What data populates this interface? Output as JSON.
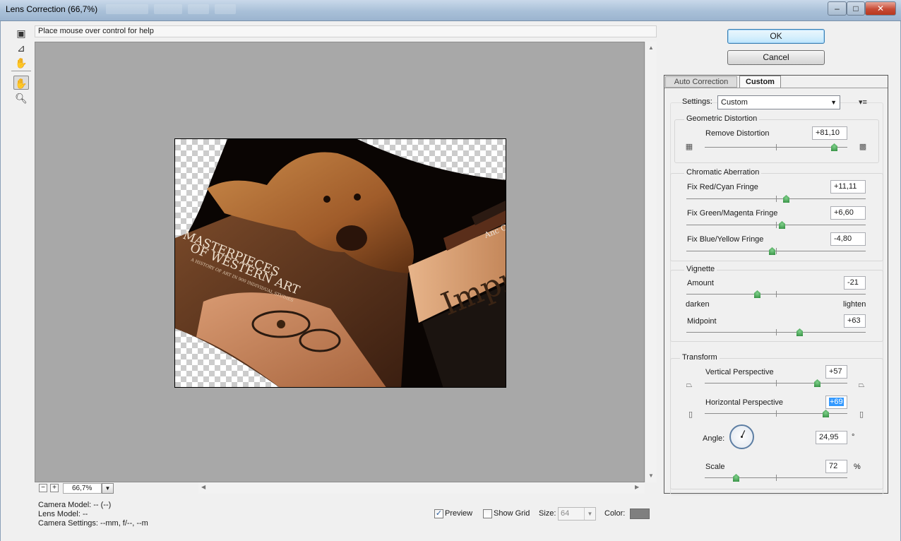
{
  "window": {
    "title": "Lens Correction (66,7%)",
    "min_glyph": "–",
    "max_glyph": "□",
    "close_glyph": "✕"
  },
  "help_text": "Place mouse over control for help",
  "zoom": {
    "value": "66,7%",
    "minus": "−",
    "plus": "+"
  },
  "camera": {
    "model": "Camera Model: -- (--)",
    "lens": "Lens Model: --",
    "settings": "Camera Settings: --mm, f/--, --m"
  },
  "options": {
    "preview_label": "Preview",
    "preview_checked": true,
    "show_grid_label": "Show Grid",
    "show_grid_checked": false,
    "size_label": "Size:",
    "size_value": "64",
    "color_label": "Color:",
    "grid_color": "#7f7f7f"
  },
  "buttons": {
    "ok": "OK",
    "cancel": "Cancel"
  },
  "tabs": [
    {
      "label": "Auto Correction",
      "active": false
    },
    {
      "label": "Custom",
      "active": true
    }
  ],
  "settings": {
    "label": "Settings:",
    "value": "Custom",
    "menu_icon": "▾≡"
  },
  "geometric": {
    "title": "Geometric Distortion",
    "remove_distortion": {
      "label": "Remove Distortion",
      "value": "+81,10",
      "level": 0.905
    }
  },
  "chromatic": {
    "title": "Chromatic Aberration",
    "red_cyan": {
      "label": "Fix Red/Cyan Fringe",
      "value": "+11,11",
      "level": 0.556
    },
    "green_magenta": {
      "label": "Fix Green/Magenta Fringe",
      "value": "+6,60",
      "level": 0.533
    },
    "blue_yellow": {
      "label": "Fix Blue/Yellow Fringe",
      "value": "-4,80",
      "level": 0.476
    }
  },
  "vignette": {
    "title": "Vignette",
    "amount": {
      "label": "Amount",
      "value": "-21",
      "level": 0.395
    },
    "darken": "darken",
    "lighten": "lighten",
    "midpoint": {
      "label": "Midpoint",
      "value": "+63",
      "level": 0.63
    }
  },
  "transform": {
    "title": "Transform",
    "vertical": {
      "label": "Vertical Perspective",
      "value": "+57",
      "level": 0.785
    },
    "horizontal": {
      "label": "Horizontal Perspective",
      "value": "+69",
      "level": 0.845
    },
    "angle": {
      "label": "Angle:",
      "value": "24,95",
      "unit": "°"
    },
    "scale": {
      "label": "Scale",
      "value": "72",
      "unit": "%",
      "level": 0.22
    }
  },
  "photo_text": {
    "book_title_1": "MASTERPIECES",
    "book_title_2": "OF WESTERN ART",
    "book_subtitle": "A HISTORY OF ART IN 900 INDIVIDUAL STUDIES",
    "spine_text": "Impr",
    "spine_small": "Anc Chin"
  }
}
